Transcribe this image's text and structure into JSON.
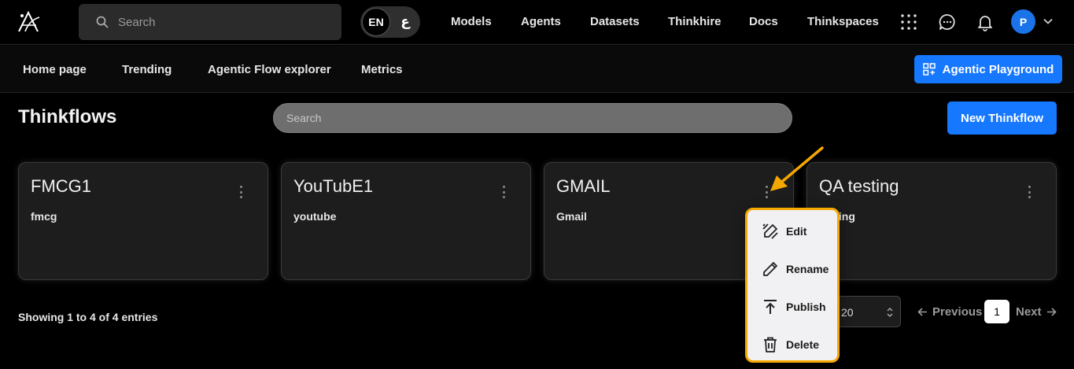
{
  "topnav": {
    "search_placeholder": "Search",
    "lang_en": "EN",
    "lang_ar": "ع",
    "links": [
      "Models",
      "Agents",
      "Datasets",
      "Thinkhire",
      "Docs",
      "Thinkspaces"
    ],
    "avatar_initial": "P"
  },
  "subnav": {
    "links": [
      "Home page",
      "Trending",
      "Agentic Flow explorer",
      "Metrics"
    ],
    "playground_label": "Agentic Playground"
  },
  "main": {
    "title": "Thinkflows",
    "search_placeholder": "Search",
    "new_button": "New Thinkflow",
    "cards": [
      {
        "title": "FMCG1",
        "description": "fmcg"
      },
      {
        "title": "YouTubE1",
        "description": "youtube"
      },
      {
        "title": "GMAIL",
        "description": "Gmail"
      },
      {
        "title": "QA testing",
        "description": "testing"
      }
    ],
    "entries_text": "Showing 1 to 4 of 4 entries",
    "page_size": "20",
    "prev_label": "Previous",
    "current_page": "1",
    "next_label": "Next"
  },
  "context_menu": {
    "items": [
      {
        "label": "Edit",
        "icon": "edit-pen-lines-icon"
      },
      {
        "label": "Rename",
        "icon": "pencil-icon"
      },
      {
        "label": "Publish",
        "icon": "upload-icon"
      },
      {
        "label": "Delete",
        "icon": "trash-icon"
      }
    ]
  },
  "colors": {
    "accent": "#1677ff",
    "highlight": "#f5a800",
    "background": "#000000",
    "card": "#1d1d1d"
  }
}
